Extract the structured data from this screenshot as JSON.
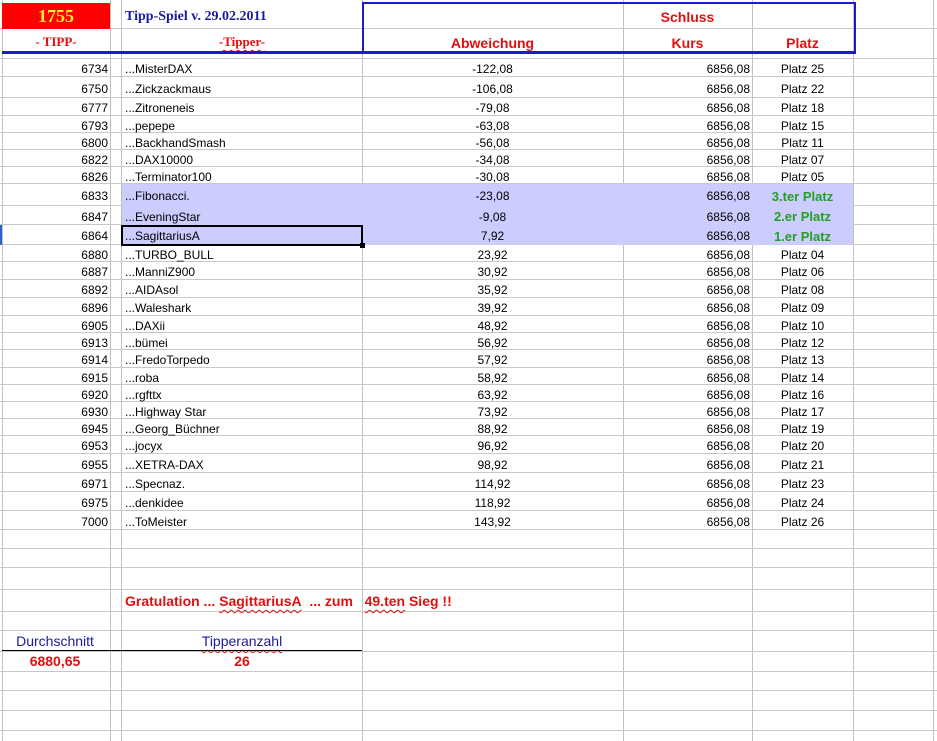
{
  "header": {
    "count": "1755",
    "title": "Tipp-Spiel v. 29.02.2011",
    "schluss": "Schluss",
    "col_tipp": "- TIPP-",
    "col_tipper": "-Tipper-",
    "col_abweichung": "Abweichung",
    "col_kurs": "Kurs",
    "col_platz": "Platz"
  },
  "colors": {
    "highlight": "#ccccff",
    "accent_red": "#e01010",
    "title_blue": "#1a1aa0",
    "winner_green": "#22a022"
  },
  "rows": [
    {
      "tipp": "6734",
      "tipper": "...MisterDAX",
      "abw": "-122,08",
      "kurs": "6856,08",
      "platz": "Platz 25"
    },
    {
      "tipp": "6750",
      "tipper": "...Zickzackmaus",
      "abw": "-106,08",
      "kurs": "6856,08",
      "platz": "Platz 22"
    },
    {
      "tipp": "6777",
      "tipper": "...Zitroneneis",
      "abw": "-79,08",
      "kurs": "6856,08",
      "platz": "Platz 18"
    },
    {
      "tipp": "6793",
      "tipper": "...pepepe",
      "abw": "-63,08",
      "kurs": "6856,08",
      "platz": "Platz 15"
    },
    {
      "tipp": "6800",
      "tipper": "...BackhandSmash",
      "abw": "-56,08",
      "kurs": "6856,08",
      "platz": "Platz 11"
    },
    {
      "tipp": "6822",
      "tipper": "...DAX10000",
      "abw": "-34,08",
      "kurs": "6856,08",
      "platz": "Platz 07"
    },
    {
      "tipp": "6826",
      "tipper": "...Terminator100",
      "abw": "-30,08",
      "kurs": "6856,08",
      "platz": "Platz 05"
    },
    {
      "tipp": "6833",
      "tipper": "...Fibonacci.",
      "abw": "-23,08",
      "kurs": "6856,08",
      "platz": "3.ter Platz",
      "top": true
    },
    {
      "tipp": "6847",
      "tipper": "...EveningStar",
      "abw": "-9,08",
      "kurs": "6856,08",
      "platz": "2.er Platz",
      "top": true
    },
    {
      "tipp": "6864",
      "tipper": "...SagittariusA",
      "abw": "7,92",
      "kurs": "6856,08",
      "platz": "1.er Platz",
      "top": true,
      "selected": true
    },
    {
      "tipp": "6880",
      "tipper": "...TURBO_BULL",
      "abw": "23,92",
      "kurs": "6856,08",
      "platz": "Platz 04"
    },
    {
      "tipp": "6887",
      "tipper": "...ManniZ900",
      "abw": "30,92",
      "kurs": "6856,08",
      "platz": "Platz 06"
    },
    {
      "tipp": "6892",
      "tipper": "...AIDAsol",
      "abw": "35,92",
      "kurs": "6856,08",
      "platz": "Platz 08"
    },
    {
      "tipp": "6896",
      "tipper": "...Waleshark",
      "abw": "39,92",
      "kurs": "6856,08",
      "platz": "Platz 09"
    },
    {
      "tipp": "6905",
      "tipper": "...DAXii",
      "abw": "48,92",
      "kurs": "6856,08",
      "platz": "Platz 10"
    },
    {
      "tipp": "6913",
      "tipper": "...bümei",
      "abw": "56,92",
      "kurs": "6856,08",
      "platz": "Platz 12"
    },
    {
      "tipp": "6914",
      "tipper": "...FredoTorpedo",
      "abw": "57,92",
      "kurs": "6856,08",
      "platz": "Platz 13"
    },
    {
      "tipp": "6915",
      "tipper": "...roba",
      "abw": "58,92",
      "kurs": "6856,08",
      "platz": "Platz 14"
    },
    {
      "tipp": "6920",
      "tipper": "...rgfttx",
      "abw": "63,92",
      "kurs": "6856,08",
      "platz": "Platz 16"
    },
    {
      "tipp": "6930",
      "tipper": "...Highway Star",
      "abw": "73,92",
      "kurs": "6856,08",
      "platz": "Platz 17"
    },
    {
      "tipp": "6945",
      "tipper": "...Georg_Büchner",
      "abw": "88,92",
      "kurs": "6856,08",
      "platz": "Platz 19"
    },
    {
      "tipp": "6953",
      "tipper": "...jocyx",
      "abw": "96,92",
      "kurs": "6856,08",
      "platz": "Platz 20"
    },
    {
      "tipp": "6955",
      "tipper": "...XETRA-DAX",
      "abw": "98,92",
      "kurs": "6856,08",
      "platz": "Platz 21"
    },
    {
      "tipp": "6971",
      "tipper": "...Specnaz.",
      "abw": "114,92",
      "kurs": "6856,08",
      "platz": "Platz 23"
    },
    {
      "tipp": "6975",
      "tipper": "...denkidee",
      "abw": "118,92",
      "kurs": "6856,08",
      "platz": "Platz 24"
    },
    {
      "tipp": "7000",
      "tipper": "...ToMeister",
      "abw": "143,92",
      "kurs": "6856,08",
      "platz": "Platz 26"
    }
  ],
  "footer": {
    "gratulation": "Gratulation ...",
    "winner": "SagittariusA",
    "zum": "... zum",
    "sieg_num": "49.ten",
    "sieg": "Sieg !!",
    "avg_label": "Durchschnitt",
    "avg_value": "6880,65",
    "count_label": "Tipperanzahl",
    "count_value": "26"
  }
}
